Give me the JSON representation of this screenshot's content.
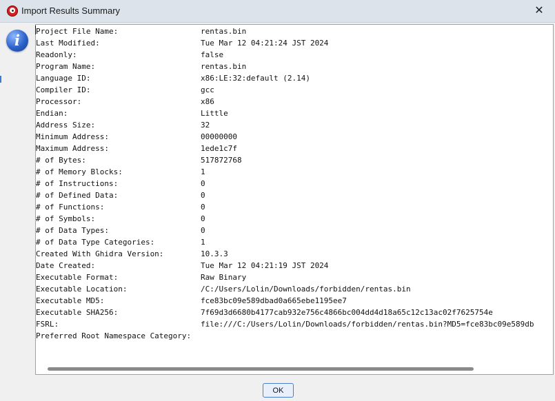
{
  "window": {
    "title": "Import Results Summary",
    "close_glyph": "✕"
  },
  "info_icon_glyph": "i",
  "fields": [
    {
      "label": "Project File Name:",
      "value": "rentas.bin"
    },
    {
      "label": "Last Modified:",
      "value": "Tue Mar 12 04:21:24 JST 2024"
    },
    {
      "label": "Readonly:",
      "value": "false"
    },
    {
      "label": "Program Name:",
      "value": "rentas.bin"
    },
    {
      "label": "Language ID:",
      "value": "x86:LE:32:default (2.14)"
    },
    {
      "label": "Compiler ID:",
      "value": "gcc"
    },
    {
      "label": "Processor:",
      "value": "x86"
    },
    {
      "label": "Endian:",
      "value": "Little"
    },
    {
      "label": "Address Size:",
      "value": "32"
    },
    {
      "label": "Minimum Address:",
      "value": "00000000"
    },
    {
      "label": "Maximum Address:",
      "value": "1ede1c7f"
    },
    {
      "label": "# of Bytes:",
      "value": "517872768"
    },
    {
      "label": "# of Memory Blocks:",
      "value": "1"
    },
    {
      "label": "# of Instructions:",
      "value": "0"
    },
    {
      "label": "# of Defined Data:",
      "value": "0"
    },
    {
      "label": "# of Functions:",
      "value": "0"
    },
    {
      "label": "# of Symbols:",
      "value": "0"
    },
    {
      "label": "# of Data Types:",
      "value": "0"
    },
    {
      "label": "# of Data Type Categories:",
      "value": "1"
    },
    {
      "label": "Created With Ghidra Version:",
      "value": "10.3.3"
    },
    {
      "label": "Date Created:",
      "value": "Tue Mar 12 04:21:19 JST 2024"
    },
    {
      "label": "Executable Format:",
      "value": "Raw Binary"
    },
    {
      "label": "Executable Location:",
      "value": "/C:/Users/Lolin/Downloads/forbidden/rentas.bin"
    },
    {
      "label": "Executable MD5:",
      "value": "fce83bc09e589dbad0a665ebe1195ee7"
    },
    {
      "label": "Executable SHA256:",
      "value": "7f69d3d6680b4177cab932e756c4866bc004dd4d18a65c12c13ac02f7625754e"
    },
    {
      "label": "FSRL:",
      "value": "file:///C:/Users/Lolin/Downloads/forbidden/rentas.bin?MD5=fce83bc09e589db"
    },
    {
      "label": "Preferred Root Namespace Category:",
      "value": ""
    }
  ],
  "buttons": {
    "ok_label": "OK"
  }
}
